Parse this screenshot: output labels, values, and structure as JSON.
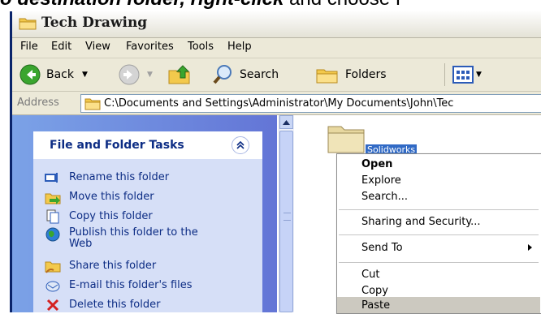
{
  "caption": {
    "part1": "o destination folder, right-click",
    "part2": " and choose P"
  },
  "window": {
    "title": "Tech Drawing"
  },
  "menu": [
    "File",
    "Edit",
    "View",
    "Favorites",
    "Tools",
    "Help"
  ],
  "toolbar": {
    "back_label": "Back",
    "search_label": "Search",
    "folders_label": "Folders"
  },
  "address": {
    "label": "Address",
    "path": "C:\\Documents and Settings\\Administrator\\My Documents\\John\\Tec"
  },
  "taskpane": {
    "title": "File and Folder Tasks",
    "items": [
      {
        "label": "Rename this folder",
        "icon": "rename-icon"
      },
      {
        "label": "Move this folder",
        "icon": "move-icon"
      },
      {
        "label": "Copy this folder",
        "icon": "copy-icon"
      },
      {
        "label": "Publish this folder to the Web",
        "icon": "publish-web-icon"
      },
      {
        "label": "Share this folder",
        "icon": "share-icon"
      },
      {
        "label": "E-mail this folder's files",
        "icon": "email-icon"
      },
      {
        "label": "Delete this folder",
        "icon": "delete-icon"
      }
    ]
  },
  "folder": {
    "name": "Solidworks"
  },
  "context_menu": {
    "items": [
      "Open",
      "Explore",
      "Search...",
      "Sharing and Security...",
      "Send To",
      "Cut",
      "Copy",
      "Paste"
    ],
    "highlighted": "Paste"
  },
  "colors": {
    "taskpane_bg": "#6f8ce0",
    "task_text": "#0c2c84",
    "selection": "#316ac5"
  }
}
